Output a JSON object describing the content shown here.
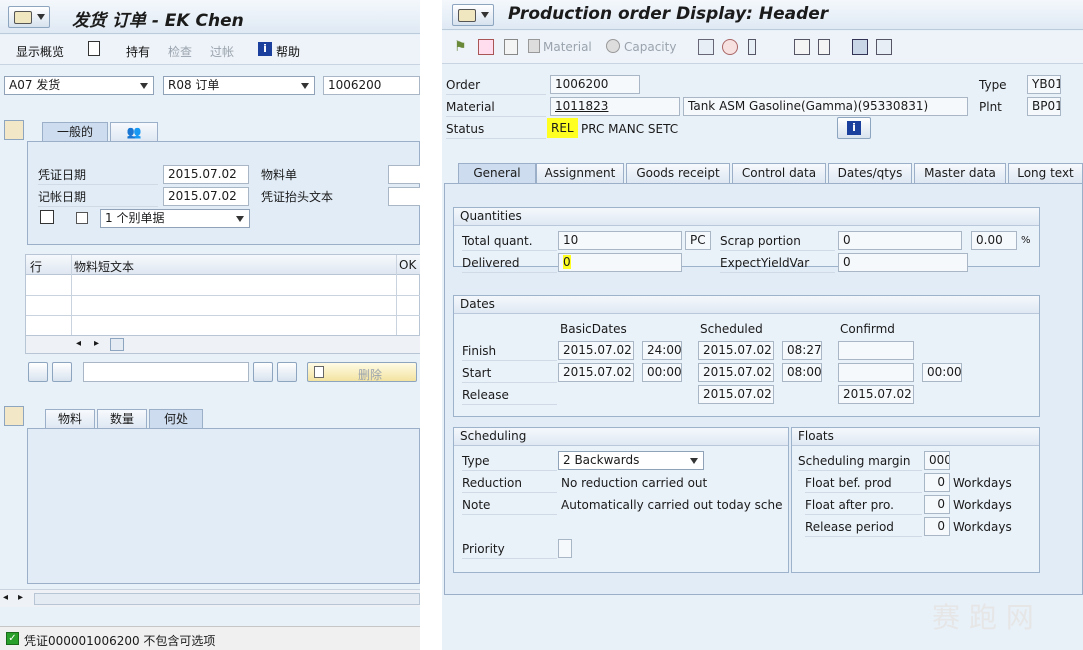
{
  "left": {
    "title": "发货 订单 - EK Chen",
    "toolbar": {
      "overview": "显示概览",
      "hold": "持有",
      "check": "检查",
      "post": "过帐",
      "help": "帮助"
    },
    "selectors": {
      "movement": "A07 发货",
      "reference": "R08 订单",
      "order": "1006200"
    },
    "tabs_top": [
      "一般的"
    ],
    "general": {
      "doc_date_label": "凭证日期",
      "doc_date": "2015.07.02",
      "post_date_label": "记帐日期",
      "post_date": "2015.07.02",
      "material_slip_label": "物料单",
      "header_text_label": "凭证抬头文本",
      "doc_combo": "1 个别单据"
    },
    "table": {
      "col_row": "行",
      "col_text": "物料短文本",
      "col_ok": "OK"
    },
    "delete_label": "删除",
    "tabs_bottom": [
      "物料",
      "数量",
      "何处"
    ],
    "status": "凭证000001006200   不包含可选项"
  },
  "right": {
    "title": "Production order Display: Header",
    "toolbar": {
      "material": "Material",
      "capacity": "Capacity"
    },
    "header": {
      "order_label": "Order",
      "order": "1006200",
      "material_label": "Material",
      "material": "1011823",
      "material_desc": "Tank ASM Gasoline(Gamma)(95330831)",
      "status_label": "Status",
      "status_rel": "REL",
      "status_rest": "PRC  MANC SETC",
      "type_label": "Type",
      "type": "YB01",
      "plnt_label": "Plnt",
      "plnt": "BP01"
    },
    "tabs": [
      "General",
      "Assignment",
      "Goods receipt",
      "Control data",
      "Dates/qtys",
      "Master data",
      "Long text"
    ],
    "quantities": {
      "title": "Quantities",
      "total_label": "Total quant.",
      "total": "10",
      "unit": "PC",
      "delivered_label": "Delivered",
      "delivered": "0",
      "scrap_label": "Scrap portion",
      "scrap": "0",
      "scrap_pct": "0.00",
      "pct_sign": "%",
      "yield_label": "ExpectYieldVar",
      "yield": "0"
    },
    "dates": {
      "title": "Dates",
      "col_basic": "BasicDates",
      "col_sched": "Scheduled",
      "col_conf": "Confirmd",
      "finish_label": "Finish",
      "start_label": "Start",
      "release_label": "Release",
      "finish_basic": "2015.07.02",
      "finish_basic_t": "24:00",
      "finish_sched": "2015.07.02",
      "finish_sched_t": "08:27",
      "start_basic": "2015.07.02",
      "start_basic_t": "00:00",
      "start_sched": "2015.07.02",
      "start_sched_t": "08:00",
      "start_conf_t": "00:00",
      "release_sched": "2015.07.02",
      "release_conf": "2015.07.02"
    },
    "scheduling": {
      "title": "Scheduling",
      "type_label": "Type",
      "type": "2 Backwards",
      "reduction_label": "Reduction",
      "reduction": "No reduction carried out",
      "note_label": "Note",
      "note": "Automatically carried out today sched…",
      "priority_label": "Priority"
    },
    "floats": {
      "title": "Floats",
      "margin_label": "Scheduling margin",
      "margin": "000",
      "bef_label": "Float bef. prod",
      "bef": "0",
      "after_label": "Float after pro.",
      "after": "0",
      "release_label": "Release period",
      "release": "0",
      "unit": "Workdays"
    }
  }
}
